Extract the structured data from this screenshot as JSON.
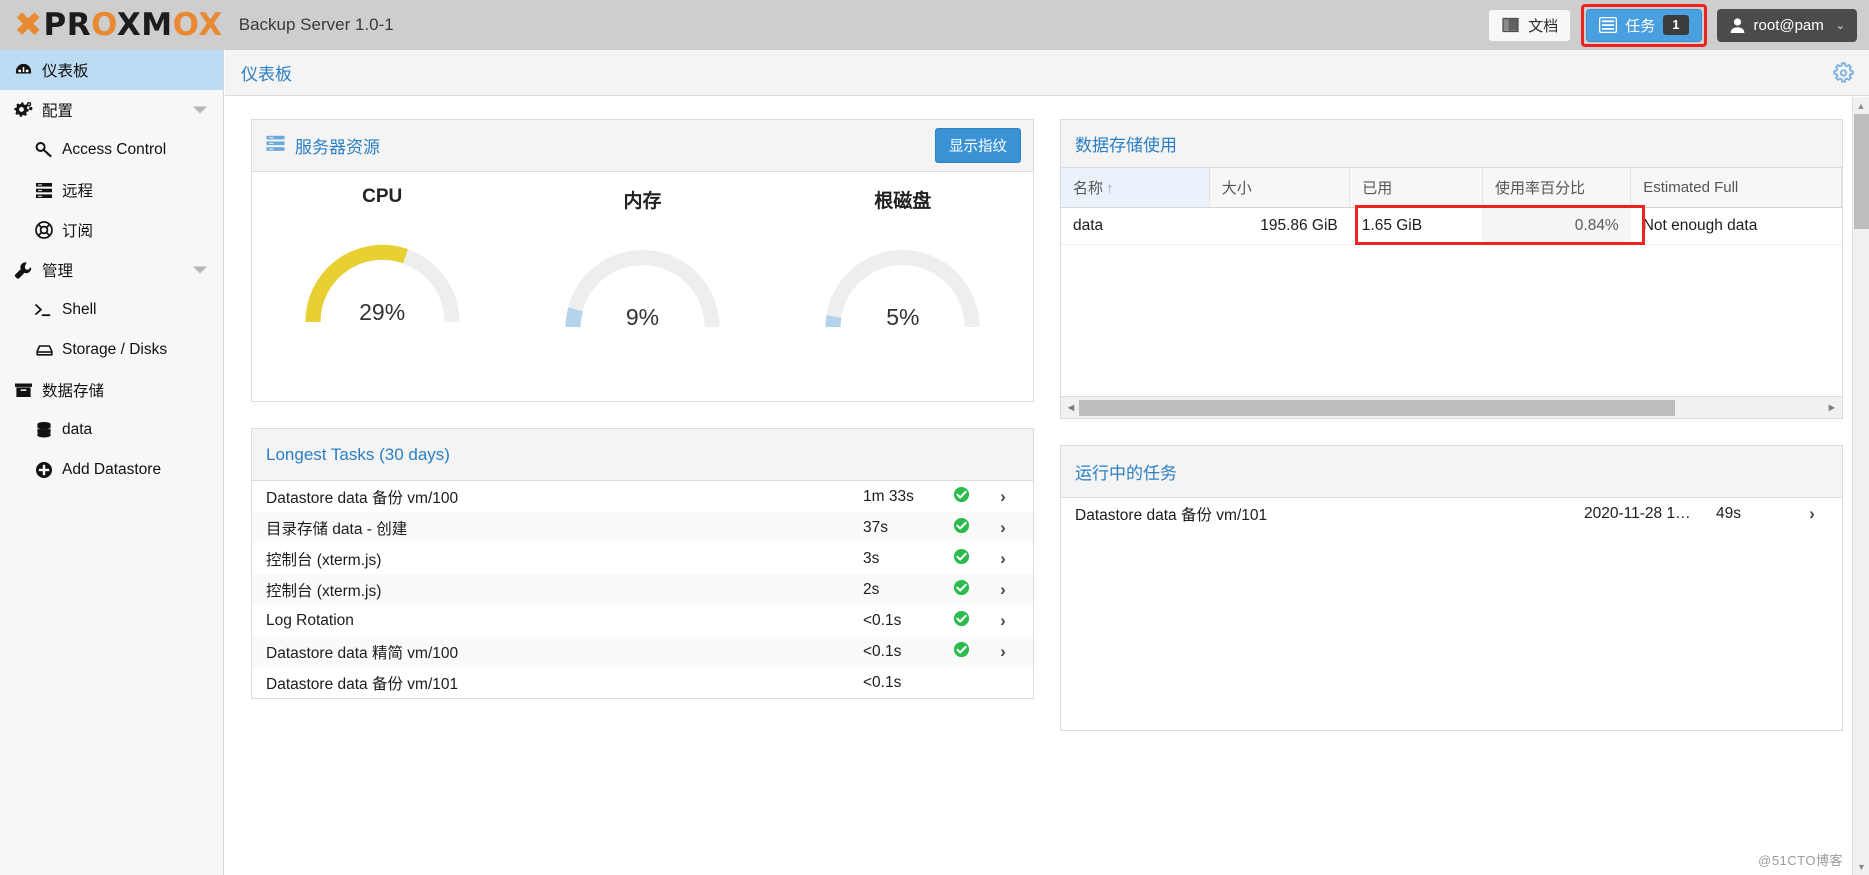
{
  "header": {
    "logo_x": "X",
    "logo_parts": [
      "PR",
      "O",
      "XM",
      "O",
      "X"
    ],
    "logo_text": "PROXMOX",
    "product_title": "Backup Server 1.0-1",
    "docs_label": "文档",
    "docs_icon": "book-icon",
    "tasks_label": "任务",
    "tasks_icon": "list-icon",
    "tasks_badge": "1",
    "user_label": "root@pam",
    "user_icon": "user-icon",
    "caret": "⌄",
    "accent_blue": "#4a9fe0",
    "highlight_red": "#ee2222"
  },
  "sidebar": {
    "items": [
      {
        "label": "仪表板",
        "icon": "dashboard-icon",
        "level": 0,
        "selected": true,
        "collapsible": false
      },
      {
        "label": "配置",
        "icon": "gears-icon",
        "level": 0,
        "selected": false,
        "collapsible": true
      },
      {
        "label": "Access Control",
        "icon": "key-icon",
        "level": 1,
        "selected": false,
        "collapsible": false
      },
      {
        "label": "远程",
        "icon": "server-icon",
        "level": 1,
        "selected": false,
        "collapsible": false
      },
      {
        "label": "订阅",
        "icon": "lifering-icon",
        "level": 1,
        "selected": false,
        "collapsible": false
      },
      {
        "label": "管理",
        "icon": "wrench-icon",
        "level": 0,
        "selected": false,
        "collapsible": true
      },
      {
        "label": "Shell",
        "icon": "terminal-icon",
        "level": 1,
        "selected": false,
        "collapsible": false
      },
      {
        "label": "Storage / Disks",
        "icon": "hdd-icon",
        "level": 1,
        "selected": false,
        "collapsible": false
      },
      {
        "label": "数据存储",
        "icon": "archive-icon",
        "level": 0,
        "selected": false,
        "collapsible": false
      },
      {
        "label": "data",
        "icon": "database-icon",
        "level": 1,
        "selected": false,
        "collapsible": false
      },
      {
        "label": "Add Datastore",
        "icon": "plus-circle-icon",
        "level": 1,
        "selected": false,
        "collapsible": false
      }
    ]
  },
  "breadcrumb": {
    "title": "仪表板",
    "settings_icon": "gear-icon"
  },
  "server_resources": {
    "title": "服务器资源",
    "title_icon": "server-icon",
    "fingerprint_button": "显示指纹",
    "gauges": [
      {
        "label": "CPU",
        "value": 29,
        "value_text": "29%",
        "color": "#e8cf32"
      },
      {
        "label": "内存",
        "value": 9,
        "value_text": "9%",
        "color": "#b3d4ec"
      },
      {
        "label": "根磁盘",
        "value": 5,
        "value_text": "5%",
        "color": "#b3d4ec"
      }
    ],
    "track_color": "#eeeeee"
  },
  "datastore_usage": {
    "title": "数据存储使用",
    "columns": [
      {
        "label": "名称",
        "sorted": true,
        "sort_arrow": "↑"
      },
      {
        "label": "大小",
        "sorted": false,
        "sort_arrow": ""
      },
      {
        "label": "已用",
        "sorted": false,
        "sort_arrow": ""
      },
      {
        "label": "使用率百分比",
        "sorted": false,
        "sort_arrow": ""
      },
      {
        "label": "Estimated Full",
        "sorted": false,
        "sort_arrow": ""
      }
    ],
    "rows": [
      {
        "name": "data",
        "size": "195.86 GiB",
        "used": "1.65 GiB",
        "percent": "0.84%",
        "estimated_full": "Not enough data"
      }
    ],
    "scroll_left_arrow": "◄",
    "scroll_right_arrow": "►"
  },
  "longest_tasks": {
    "title": "Longest Tasks (30 days)",
    "rows": [
      {
        "name": "Datastore data 备份 vm/100",
        "duration": "1m 33s",
        "status": "ok",
        "chevron": "›"
      },
      {
        "name": "目录存储 data - 创建",
        "duration": "37s",
        "status": "ok",
        "chevron": "›"
      },
      {
        "name": "控制台 (xterm.js)",
        "duration": "3s",
        "status": "ok",
        "chevron": "›"
      },
      {
        "name": "控制台 (xterm.js)",
        "duration": "2s",
        "status": "ok",
        "chevron": "›"
      },
      {
        "name": "Log Rotation",
        "duration": "<0.1s",
        "status": "ok",
        "chevron": "›"
      },
      {
        "name": "Datastore data 精简 vm/100",
        "duration": "<0.1s",
        "status": "ok",
        "chevron": "›"
      },
      {
        "name": "Datastore data 备份 vm/101",
        "duration": "<0.1s",
        "status": "none",
        "chevron": ""
      }
    ]
  },
  "running_tasks": {
    "title": "运行中的任务",
    "rows": [
      {
        "name": "Datastore data 备份 vm/101",
        "start_time": "2020-11-28 1…",
        "duration": "49s",
        "chevron": "›"
      }
    ]
  },
  "watermark": "@51CTO博客"
}
